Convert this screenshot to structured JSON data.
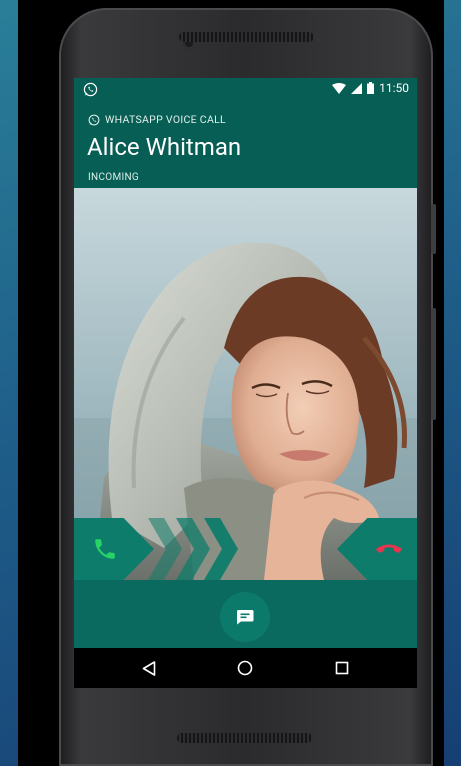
{
  "status_bar": {
    "time": "11:50",
    "icons": [
      "whatsapp-icon",
      "wifi-icon",
      "signal-icon",
      "battery-icon"
    ]
  },
  "call": {
    "label": "WHATSAPP VOICE CALL",
    "caller_name": "Alice Whitman",
    "status": "INCOMING"
  },
  "actions": {
    "accept_icon": "phone-icon",
    "decline_icon": "phone-hangup-icon",
    "message_icon": "message-icon"
  },
  "nav": {
    "items": [
      "back-icon",
      "home-icon",
      "recents-icon"
    ]
  },
  "colors": {
    "brand": "#075e54",
    "accept": "#25d366",
    "decline": "#e8344e"
  }
}
